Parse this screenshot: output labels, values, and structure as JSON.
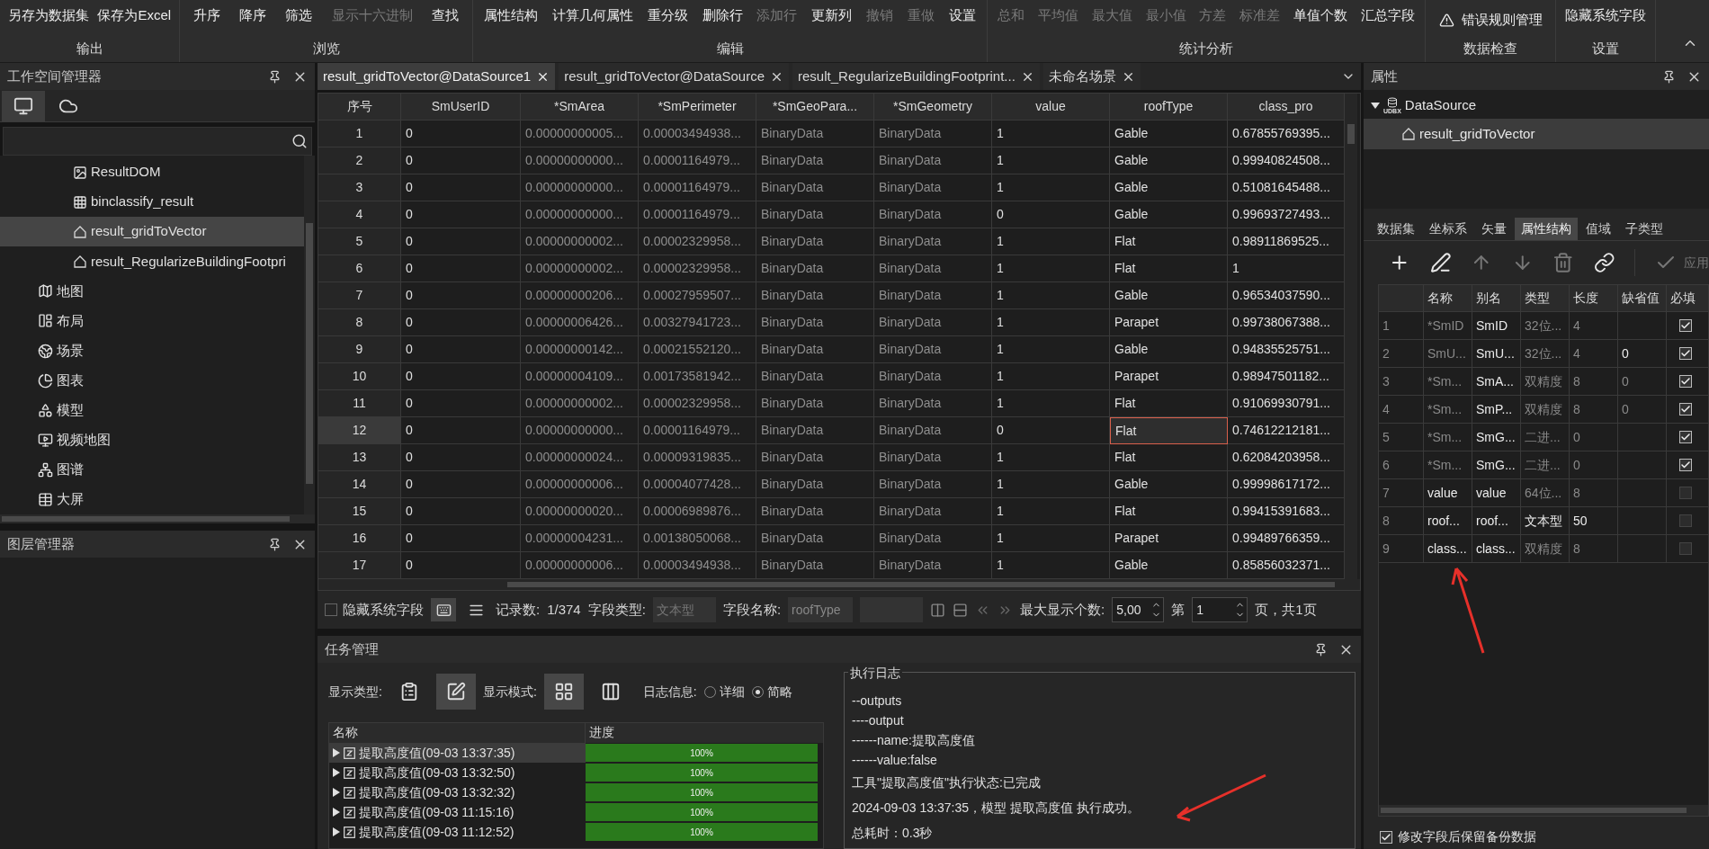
{
  "ribbon": {
    "groups": [
      {
        "label": "输出",
        "kind": "text",
        "buttons": [
          {
            "label": "另存为数据集",
            "disabled": false
          },
          {
            "label": "保存为Excel",
            "disabled": false
          }
        ]
      },
      {
        "label": "浏览",
        "kind": "text",
        "buttons": [
          {
            "label": "升序",
            "disabled": false
          },
          {
            "label": "降序",
            "disabled": false
          },
          {
            "label": "筛选",
            "disabled": false
          },
          {
            "label": "显示十六进制",
            "disabled": true
          },
          {
            "label": "查找",
            "disabled": false
          }
        ]
      },
      {
        "label": "编辑",
        "kind": "text",
        "buttons": [
          {
            "label": "属性结构",
            "disabled": false
          },
          {
            "label": "计算几何属性",
            "disabled": false
          },
          {
            "label": "重分级",
            "disabled": false
          },
          {
            "label": "删除行",
            "disabled": false
          },
          {
            "label": "添加行",
            "disabled": true
          },
          {
            "label": "更新列",
            "disabled": false
          },
          {
            "label": "撤销",
            "disabled": true
          },
          {
            "label": "重做",
            "disabled": true
          },
          {
            "label": "设置",
            "disabled": false
          }
        ]
      },
      {
        "label": "统计分析",
        "kind": "text",
        "buttons": [
          {
            "label": "总和",
            "disabled": true
          },
          {
            "label": "平均值",
            "disabled": true
          },
          {
            "label": "最大值",
            "disabled": true
          },
          {
            "label": "最小值",
            "disabled": true
          },
          {
            "label": "方差",
            "disabled": true
          },
          {
            "label": "标准差",
            "disabled": true
          },
          {
            "label": "单值个数",
            "disabled": false
          },
          {
            "label": "汇总字段",
            "disabled": false
          }
        ]
      },
      {
        "label": "数据检查",
        "kind": "icon",
        "buttons": [
          {
            "label": "错误规则管理",
            "disabled": false
          }
        ]
      },
      {
        "label": "设置",
        "kind": "text",
        "buttons": [
          {
            "label": "隐藏系统字段",
            "disabled": false
          }
        ]
      }
    ]
  },
  "workspace": {
    "title": "工作空间管理器",
    "tabs": [
      {
        "selected": true
      },
      {
        "selected": false
      }
    ],
    "datasets": [
      {
        "label": "ResultDOM",
        "selected": false
      },
      {
        "label": "binclassify_result",
        "selected": false
      },
      {
        "label": "result_gridToVector",
        "selected": true
      },
      {
        "label": "result_RegularizeBuildingFootpri",
        "selected": false
      }
    ],
    "sections": [
      "地图",
      "布局",
      "场景",
      "图表",
      "模型",
      "视频地图",
      "图谱",
      "大屏"
    ]
  },
  "layers": {
    "title": "图层管理器"
  },
  "document_tabs": [
    {
      "label": "result_gridToVector@DataSource1",
      "selected": true
    },
    {
      "label": "result_gridToVector@DataSource",
      "selected": false
    },
    {
      "label": "result_RegularizeBuildingFootprint...",
      "selected": false
    },
    {
      "label": "未命名场景",
      "selected": false
    }
  ],
  "table": {
    "index_header": "序号",
    "columns": [
      {
        "label": "SmUserID",
        "disabled": false,
        "current": false
      },
      {
        "label": "*SmArea",
        "disabled": true,
        "current": false
      },
      {
        "label": "*SmPerimeter",
        "disabled": true,
        "current": false
      },
      {
        "label": "*SmGeoPara...",
        "disabled": true,
        "current": false
      },
      {
        "label": "*SmGeometry",
        "disabled": true,
        "current": false
      },
      {
        "label": "value",
        "disabled": false,
        "current": false
      },
      {
        "label": "roofType",
        "disabled": false,
        "current": true
      },
      {
        "label": "class_pro",
        "disabled": false,
        "current": false
      }
    ],
    "rows": [
      {
        "num": "1",
        "selected": false,
        "cells": [
          "0",
          "0.00000000005...",
          "0.00003494938...",
          "BinaryData",
          "BinaryData",
          "1",
          "Gable",
          "0.67855769395..."
        ]
      },
      {
        "num": "2",
        "selected": false,
        "cells": [
          "0",
          "0.00000000000...",
          "0.00001164979...",
          "BinaryData",
          "BinaryData",
          "1",
          "Gable",
          "0.99940824508..."
        ]
      },
      {
        "num": "3",
        "selected": false,
        "cells": [
          "0",
          "0.00000000000...",
          "0.00001164979...",
          "BinaryData",
          "BinaryData",
          "1",
          "Gable",
          "0.51081645488..."
        ]
      },
      {
        "num": "4",
        "selected": false,
        "cells": [
          "0",
          "0.00000000000...",
          "0.00001164979...",
          "BinaryData",
          "BinaryData",
          "0",
          "Gable",
          "0.99693727493..."
        ]
      },
      {
        "num": "5",
        "selected": false,
        "cells": [
          "0",
          "0.00000000002...",
          "0.00002329958...",
          "BinaryData",
          "BinaryData",
          "1",
          "Flat",
          "0.98911869525..."
        ]
      },
      {
        "num": "6",
        "selected": false,
        "cells": [
          "0",
          "0.00000000002...",
          "0.00002329958...",
          "BinaryData",
          "BinaryData",
          "1",
          "Flat",
          "1"
        ]
      },
      {
        "num": "7",
        "selected": false,
        "cells": [
          "0",
          "0.00000000206...",
          "0.00027959507...",
          "BinaryData",
          "BinaryData",
          "1",
          "Gable",
          "0.96534037590..."
        ]
      },
      {
        "num": "8",
        "selected": false,
        "cells": [
          "0",
          "0.00000006426...",
          "0.00327941723...",
          "BinaryData",
          "BinaryData",
          "1",
          "Parapet",
          "0.99738067388..."
        ]
      },
      {
        "num": "9",
        "selected": false,
        "cells": [
          "0",
          "0.00000000142...",
          "0.00021552120...",
          "BinaryData",
          "BinaryData",
          "1",
          "Gable",
          "0.94835525751..."
        ]
      },
      {
        "num": "10",
        "selected": false,
        "cells": [
          "0",
          "0.00000004109...",
          "0.00173581942...",
          "BinaryData",
          "BinaryData",
          "1",
          "Parapet",
          "0.98947501182..."
        ]
      },
      {
        "num": "11",
        "selected": false,
        "cells": [
          "0",
          "0.00000000002...",
          "0.00002329958...",
          "BinaryData",
          "BinaryData",
          "1",
          "Flat",
          "0.91069930791..."
        ]
      },
      {
        "num": "12",
        "selected": true,
        "cells": [
          "0",
          "0.00000000000...",
          "0.00001164979...",
          "BinaryData",
          "BinaryData",
          "0",
          "Flat",
          "0.74612212181..."
        ]
      },
      {
        "num": "13",
        "selected": false,
        "cells": [
          "0",
          "0.00000000024...",
          "0.00009319835...",
          "BinaryData",
          "BinaryData",
          "1",
          "Flat",
          "0.62084203958..."
        ]
      },
      {
        "num": "14",
        "selected": false,
        "cells": [
          "0",
          "0.00000000006...",
          "0.00004077428...",
          "BinaryData",
          "BinaryData",
          "1",
          "Gable",
          "0.99998617172..."
        ]
      },
      {
        "num": "15",
        "selected": false,
        "cells": [
          "0",
          "0.00000000020...",
          "0.00006989876...",
          "BinaryData",
          "BinaryData",
          "1",
          "Flat",
          "0.99415391683..."
        ]
      },
      {
        "num": "16",
        "selected": false,
        "cells": [
          "0",
          "0.00000004231...",
          "0.00138050068...",
          "BinaryData",
          "BinaryData",
          "1",
          "Parapet",
          "0.99489766359..."
        ]
      },
      {
        "num": "17",
        "selected": false,
        "cells": [
          "0",
          "0.00000000006...",
          "0.00003494938...",
          "BinaryData",
          "BinaryData",
          "1",
          "Gable",
          "0.85856032371..."
        ]
      }
    ]
  },
  "table_footer": {
    "hide_system_fields": {
      "label": "隐藏系统字段",
      "checked": false
    },
    "view_buttons": [
      {
        "selected": true
      },
      {
        "selected": false
      }
    ],
    "record_count_label": "记录数:",
    "record_count": "1/374",
    "field_type_label": "字段类型:",
    "field_type": "文本型",
    "field_name_label": "字段名称:",
    "field_name": "roofType",
    "max_display_label": "最大显示个数:",
    "max_display": "5,00",
    "page_label": "第",
    "page": "1",
    "page_total": "页，共1页"
  },
  "tasks": {
    "title": "任务管理",
    "display_type_label": "显示类型:",
    "display_type_buttons": [
      {
        "selected": false
      },
      {
        "selected": true
      }
    ],
    "display_mode_label": "显示模式:",
    "display_mode_buttons": [
      {
        "selected": true
      },
      {
        "selected": false
      }
    ],
    "log_info_label": "日志信息:",
    "log_options": [
      {
        "label": "详细",
        "selected": false
      },
      {
        "label": "简略",
        "selected": true
      }
    ],
    "columns": [
      "名称",
      "进度"
    ],
    "rows": [
      {
        "name": "提取高度值(09-03 13:37:35)",
        "progress": "100%",
        "level": 1,
        "selected": true
      },
      {
        "name": "提取高度值(09-03 13:32:50)",
        "progress": "100%",
        "level": 1,
        "selected": false
      },
      {
        "name": "提取高度值(09-03 13:32:32)",
        "progress": "100%",
        "level": 1,
        "selected": false
      },
      {
        "name": "提取高度值(09-03 11:15:16)",
        "progress": "100%",
        "level": 1,
        "selected": false
      },
      {
        "name": "提取高度值(09-03 11:12:52)",
        "progress": "100%",
        "level": 1,
        "selected": false
      }
    ],
    "log": {
      "title": "执行日志",
      "lines": [
        "--outputs",
        "----output",
        "------name:提取高度值",
        "------value:false",
        "工具\"提取高度值\"执行状态:已完成",
        "2024-09-03 13:37:35，模型 提取高度值 执行成功。",
        "总耗时：0.3秒"
      ]
    }
  },
  "properties": {
    "title": "属性",
    "tree": {
      "label": "DataSource",
      "icon_text": "UDBX",
      "expanded": true,
      "children": [
        {
          "label": "result_gridToVector",
          "selected": true
        }
      ]
    },
    "tabs": [
      {
        "label": "数据集",
        "selected": false
      },
      {
        "label": "坐标系",
        "selected": false
      },
      {
        "label": "矢量",
        "selected": false
      },
      {
        "label": "属性结构",
        "selected": true
      },
      {
        "label": "值域",
        "selected": false
      },
      {
        "label": "子类型",
        "selected": false
      }
    ],
    "toolbar": [
      {
        "disabled": false
      },
      {
        "disabled": false
      },
      {
        "disabled": true
      },
      {
        "disabled": true
      },
      {
        "disabled": true
      },
      {
        "disabled": false
      }
    ],
    "apply": {
      "label": "应用",
      "disabled": true
    },
    "fields": {
      "columns": [
        "名称",
        "别名",
        "类型",
        "长度",
        "缺省值",
        "必填"
      ],
      "rows": [
        {
          "num": "1",
          "name": {
            "text": "*SmID",
            "disabled": true
          },
          "alias": {
            "text": "SmID",
            "disabled": false
          },
          "type": {
            "text": "32位...",
            "disabled": true
          },
          "length": {
            "text": "4",
            "disabled": true
          },
          "required": true
        },
        {
          "num": "2",
          "name": {
            "text": "SmU...",
            "disabled": true
          },
          "alias": {
            "text": "SmU...",
            "disabled": false
          },
          "type": {
            "text": "32位...",
            "disabled": true
          },
          "length": {
            "text": "4",
            "disabled": true
          },
          "default": {
            "text": "0",
            "disabled": false
          },
          "required": true
        },
        {
          "num": "3",
          "name": {
            "text": "*Sm...",
            "disabled": true
          },
          "alias": {
            "text": "SmA...",
            "disabled": false
          },
          "type": {
            "text": "双精度",
            "disabled": true
          },
          "length": {
            "text": "8",
            "disabled": true
          },
          "default": {
            "text": "0",
            "disabled": true
          },
          "required": true
        },
        {
          "num": "4",
          "name": {
            "text": "*Sm...",
            "disabled": true
          },
          "alias": {
            "text": "SmP...",
            "disabled": false
          },
          "type": {
            "text": "双精度",
            "disabled": true
          },
          "length": {
            "text": "8",
            "disabled": true
          },
          "default": {
            "text": "0",
            "disabled": true
          },
          "required": true
        },
        {
          "num": "5",
          "name": {
            "text": "*Sm...",
            "disabled": true
          },
          "alias": {
            "text": "SmG...",
            "disabled": false
          },
          "type": {
            "text": "二进...",
            "disabled": true
          },
          "length": {
            "text": "0",
            "disabled": true
          },
          "required": true
        },
        {
          "num": "6",
          "name": {
            "text": "*Sm...",
            "disabled": true
          },
          "alias": {
            "text": "SmG...",
            "disabled": false
          },
          "type": {
            "text": "二进...",
            "disabled": true
          },
          "length": {
            "text": "0",
            "disabled": true
          },
          "required": true
        },
        {
          "num": "7",
          "name": {
            "text": "value",
            "disabled": false
          },
          "alias": {
            "text": "value",
            "disabled": false
          },
          "type": {
            "text": "64位...",
            "disabled": true
          },
          "length": {
            "text": "8",
            "disabled": true
          },
          "required": false
        },
        {
          "num": "8",
          "name": {
            "text": "roof...",
            "disabled": false
          },
          "alias": {
            "text": "roof...",
            "disabled": false
          },
          "type": {
            "text": "文本型",
            "disabled": false
          },
          "length": {
            "text": "50",
            "disabled": false
          },
          "required": false
        },
        {
          "num": "9",
          "name": {
            "text": "class...",
            "disabled": false
          },
          "alias": {
            "text": "class...",
            "disabled": false
          },
          "type": {
            "text": "双精度",
            "disabled": true
          },
          "length": {
            "text": "8",
            "disabled": true
          },
          "required": false
        }
      ]
    },
    "keep_backup": {
      "label": "修改字段后保留备份数据",
      "checked": true
    }
  }
}
